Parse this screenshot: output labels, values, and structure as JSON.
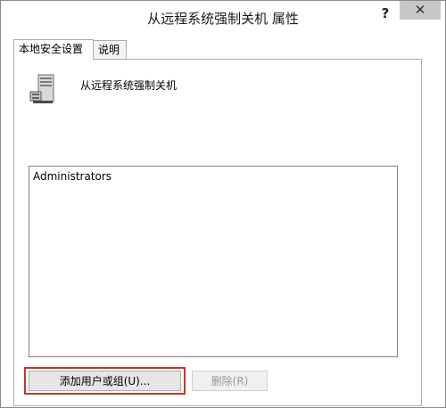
{
  "window": {
    "title": "从远程系统强制关机 属性",
    "help_glyph": "?",
    "close_glyph": "✕"
  },
  "tabs": [
    {
      "label": "本地安全设置",
      "active": true
    },
    {
      "label": "说明",
      "active": false
    }
  ],
  "policy": {
    "name": "从远程系统强制关机",
    "icon": "server-tower-icon"
  },
  "members": [
    "Administrators"
  ],
  "buttons": {
    "add_label": "添加用户或组(U)...",
    "remove_label": "删除(R)"
  },
  "colors": {
    "highlight": "#c0392b",
    "close_button": "#c7c7c7",
    "border": "#adadad"
  }
}
